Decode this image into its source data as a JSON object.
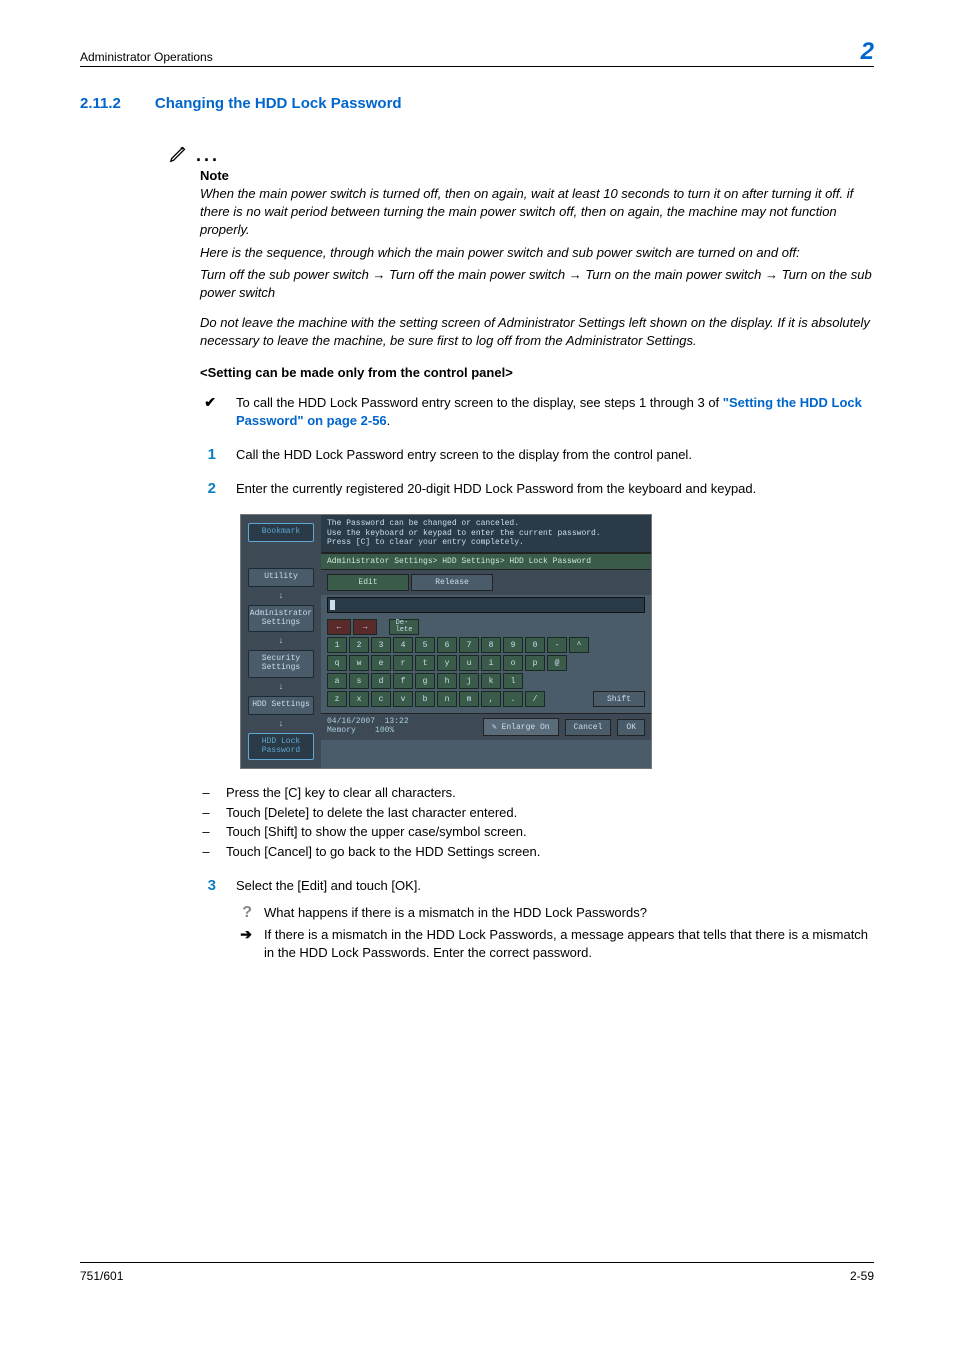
{
  "header": {
    "title": "Administrator Operations",
    "chapter_number": "2"
  },
  "section": {
    "number": "2.11.2",
    "title": "Changing the HDD Lock Password"
  },
  "note": {
    "label": "Note",
    "p1": "When the main power switch is turned off, then on again, wait at least 10 seconds to turn it on after turning it off. if there is no wait period between turning the main power switch off, then on again, the machine may not function properly.",
    "p2": "Here is the sequence, through which the main power switch and sub power switch are turned on and off:",
    "p3": "Turn off the sub power switch → Turn off the main power switch → Turn on the main power switch → Turn on the sub power switch",
    "p4": "Do not leave the machine with the setting screen of Administrator Settings left shown on the display. If it is absolutely necessary to leave the machine, be sure first to log off from the Administrator Settings."
  },
  "setting_heading": "<Setting can be made only from the control panel>",
  "bullet_check": {
    "text_prefix": "To call the HDD Lock Password entry screen to the display, see steps 1 through 3 of ",
    "link": "\"Setting the HDD Lock Password\" on page 2-56",
    "text_suffix": "."
  },
  "steps": {
    "s1": "Call the HDD Lock Password entry screen to the display from the control panel.",
    "s2": "Enter the currently registered 20-digit HDD Lock Password from the keyboard and keypad.",
    "s3": "Select the [Edit] and touch [OK]."
  },
  "dashes": {
    "d1": "Press the [C] key to clear all characters.",
    "d2": "Touch [Delete] to delete the last character entered.",
    "d3": "Touch [Shift] to show the upper case/symbol screen.",
    "d4": "Touch [Cancel] to go back to the HDD Settings screen."
  },
  "qa": {
    "q": "What happens if there is a mismatch in the HDD Lock Passwords?",
    "a": "If there is a mismatch in the HDD Lock Passwords, a message appears that tells that there is a mismatch in the HDD Lock Passwords. Enter the correct password."
  },
  "screenshot": {
    "msg_l1": "The Password can be changed or canceled.",
    "msg_l2": "Use the keyboard or keypad to enter the current password.",
    "msg_l3": "Press [C] to clear your entry completely.",
    "breadcrumb": "Administrator Settings> HDD Settings> HDD Lock Password",
    "tabs": {
      "edit": "Edit",
      "release": "Release"
    },
    "side": {
      "bookmark": "Bookmark",
      "utility": "Utility",
      "admin": "Administrator Settings",
      "security": "Security Settings",
      "hdd": "HDD Settings",
      "hddlock": "HDD Lock Password"
    },
    "keys": {
      "delete": "De-\nlete",
      "shift": "Shift",
      "row1": [
        "1",
        "2",
        "3",
        "4",
        "5",
        "6",
        "7",
        "8",
        "9",
        "0",
        "-",
        "^"
      ],
      "row2": [
        "q",
        "w",
        "e",
        "r",
        "t",
        "y",
        "u",
        "i",
        "o",
        "p",
        "@"
      ],
      "row3": [
        "a",
        "s",
        "d",
        "f",
        "g",
        "h",
        "j",
        "k",
        "l"
      ],
      "row4": [
        "z",
        "x",
        "c",
        "v",
        "b",
        "n",
        "m",
        ",",
        ".",
        "/"
      ]
    },
    "footer": {
      "date": "04/16/2007",
      "time": "13:22",
      "memory": "Memory",
      "mem_pct": "100%",
      "enlarge": "Enlarge On",
      "cancel": "Cancel",
      "ok": "OK"
    }
  },
  "footer": {
    "left": "751/601",
    "right": "2-59"
  }
}
